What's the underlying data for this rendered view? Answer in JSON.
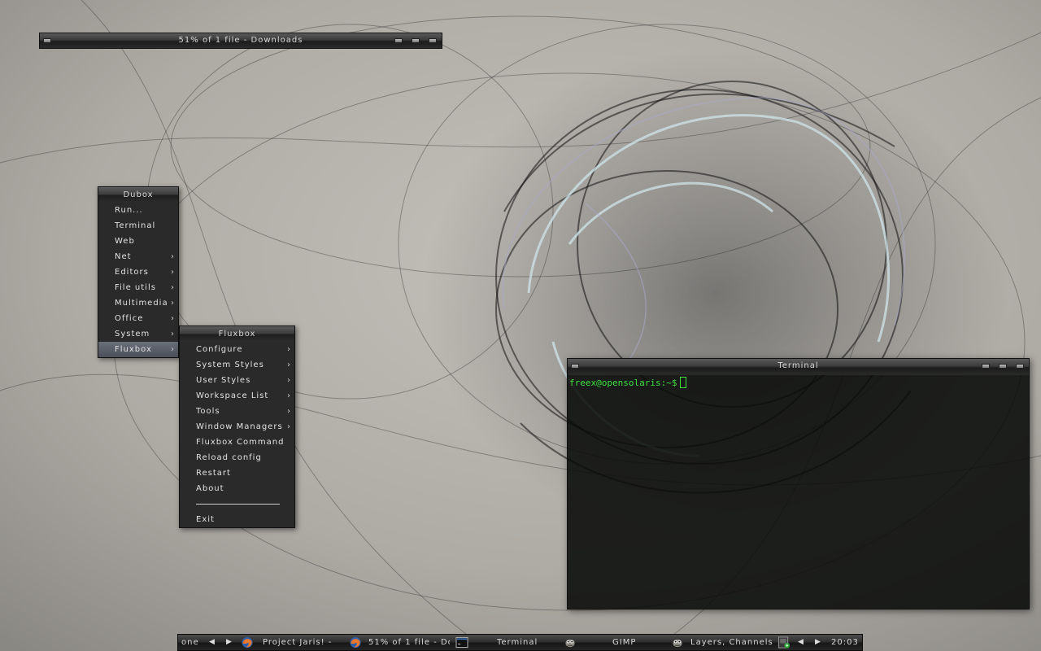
{
  "download_window": {
    "title": "51% of 1 file - Downloads"
  },
  "root_menu": {
    "title": "Dubox",
    "items": [
      {
        "label": "Run..."
      },
      {
        "label": "Terminal"
      },
      {
        "label": "Web"
      },
      {
        "label": "Net",
        "submenu": true
      },
      {
        "label": "Editors",
        "submenu": true
      },
      {
        "label": "File utils",
        "submenu": true
      },
      {
        "label": "Multimedia",
        "submenu": true
      },
      {
        "label": "Office",
        "submenu": true
      },
      {
        "label": "System",
        "submenu": true
      },
      {
        "label": "Fluxbox",
        "submenu": true,
        "active": true
      }
    ]
  },
  "fluxbox_menu": {
    "title": "Fluxbox",
    "items": [
      {
        "label": "Configure",
        "submenu": true
      },
      {
        "label": "System Styles",
        "submenu": true
      },
      {
        "label": "User Styles",
        "submenu": true
      },
      {
        "label": "Workspace List",
        "submenu": true
      },
      {
        "label": "Tools",
        "submenu": true
      },
      {
        "label": "Window Managers",
        "submenu": true
      },
      {
        "label": "Fluxbox Command"
      },
      {
        "label": "Reload config"
      },
      {
        "label": "Restart"
      },
      {
        "label": "About"
      }
    ],
    "exit_label": "Exit"
  },
  "terminal": {
    "title": "Terminal",
    "prompt": "freex@opensolaris:~$"
  },
  "taskbar": {
    "workspace": "one",
    "tasks": [
      {
        "label": "Project Jaris! -",
        "icon": "firefox-icon"
      },
      {
        "label": "51% of 1 file - Do",
        "icon": "firefox-icon"
      },
      {
        "label": "Terminal",
        "icon": "terminal-icon"
      },
      {
        "label": "GIMP",
        "icon": "gimp-icon"
      },
      {
        "label": "Layers, Channels",
        "icon": "gimp-icon"
      }
    ],
    "clock": "20:03"
  },
  "colors": {
    "terminal_text": "#3fe03f",
    "menu_bg": "#2a2a2a",
    "active_item": "#5a5f6a"
  }
}
